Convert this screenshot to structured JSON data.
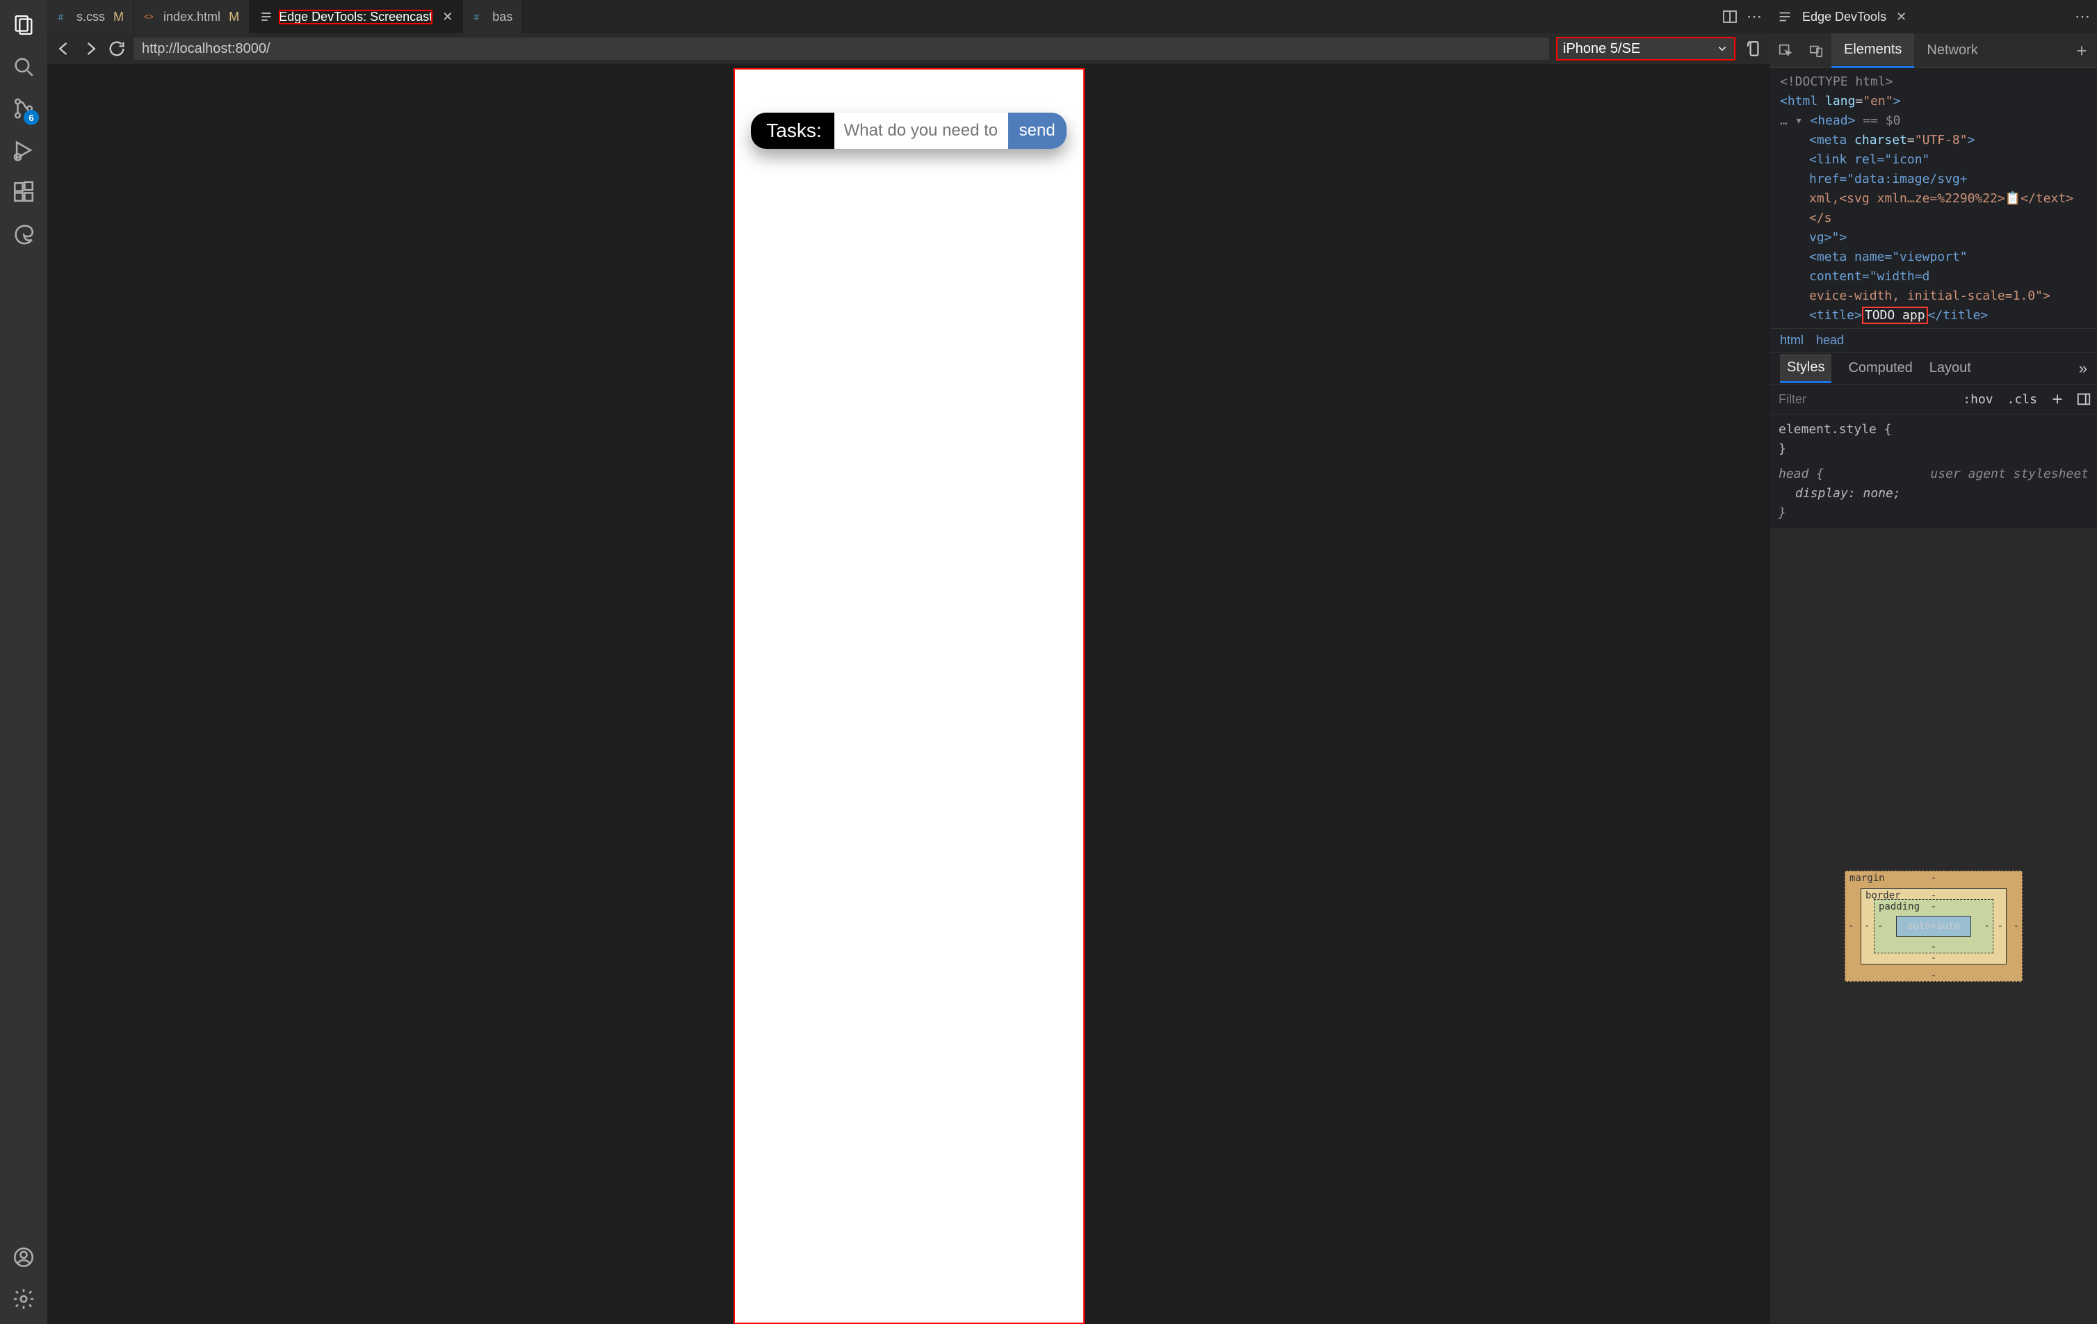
{
  "activityBar": {
    "scmBadge": "6"
  },
  "editorTabs": {
    "css": {
      "label": "s.css",
      "mod": "M"
    },
    "index": {
      "label": "index.html",
      "mod": "M"
    },
    "screencast": {
      "label": "Edge DevTools: Screencast"
    },
    "last": {
      "label": "bas"
    }
  },
  "browserBar": {
    "url": "http://localhost:8000/",
    "device": "iPhone 5/SE"
  },
  "todoApp": {
    "label": "Tasks:",
    "placeholder": "What do you need to do",
    "sendLabel": "send"
  },
  "devtools": {
    "tabTitle": "Edge DevTools",
    "panelTabs": {
      "elements": "Elements",
      "network": "Network"
    },
    "dom": {
      "doctype": "<!DOCTYPE html>",
      "htmlOpen1": "<html ",
      "htmlLang": "lang",
      "htmlLangVal": "\"en\"",
      "htmlOpen2": ">",
      "ellipsis": "…",
      "headOpen": "<head>",
      "headFlex": "== $0",
      "metaCharset1": "<meta ",
      "metaCharsetAttr": "charset",
      "metaCharsetVal": "\"UTF-8\"",
      "metaCharset2": ">",
      "linkLine1": "<link rel=\"icon\" href=\"data:image/svg+",
      "linkLine2": "xml,<svg xmln…ze=%2290%22>📋</text></s",
      "linkLine3": "vg>\">",
      "metaViewport1": "<meta name=\"viewport\" content=\"width=d",
      "metaViewport2": "evice-width, initial-scale=1.0\">",
      "titleOpen": "<title>",
      "titleText": "TODO app",
      "titleClose": "</title>"
    },
    "crumbs": {
      "c1": "html",
      "c2": "head"
    },
    "stylesTabs": {
      "styles": "Styles",
      "computed": "Computed",
      "layout": "Layout"
    },
    "filter": {
      "placeholder": "Filter",
      "hov": ":hov",
      "cls": ".cls"
    },
    "stylesBody": {
      "elStyleOpen": "element.style {",
      "brace": "}",
      "uaLabel": "user agent stylesheet",
      "headSel": "head {",
      "decl": "display: none;"
    },
    "boxModel": {
      "margin": "margin",
      "border": "border",
      "padding": "padding",
      "content": "auto×auto",
      "dash": "-"
    }
  }
}
